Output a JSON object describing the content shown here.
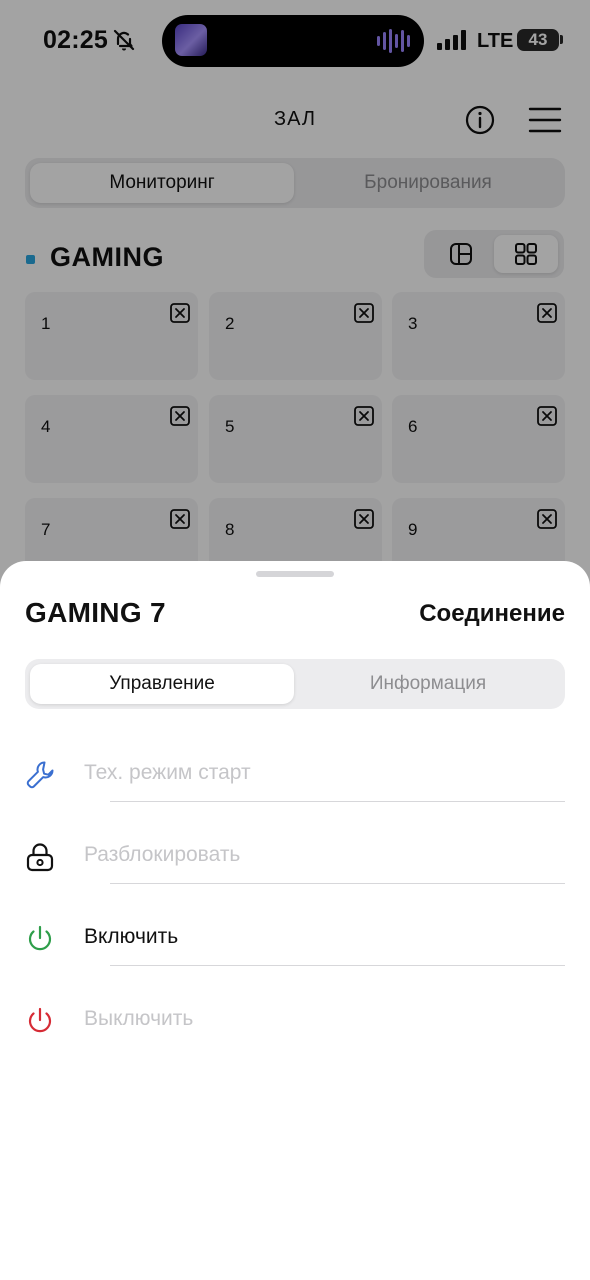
{
  "status_bar": {
    "time": "02:25",
    "network": "LTE",
    "battery": "43"
  },
  "header": {
    "title": "ЗАЛ"
  },
  "tabs": {
    "left": "Мониторинг",
    "right": "Бронирования"
  },
  "zone": {
    "name": "GAMING"
  },
  "tiles": [
    "1",
    "2",
    "3",
    "4",
    "5",
    "6",
    "7",
    "8",
    "9"
  ],
  "sheet": {
    "title": "GAMING 7",
    "status": "Соединение",
    "tabs": {
      "left": "Управление",
      "right": "Информация"
    },
    "actions": [
      {
        "label": "Тех. режим старт",
        "icon": "wrench-icon",
        "enabled": false
      },
      {
        "label": "Разблокировать",
        "icon": "lock-icon",
        "enabled": false
      },
      {
        "label": "Включить",
        "icon": "power-on-icon",
        "enabled": true
      },
      {
        "label": "Выключить",
        "icon": "power-off-icon",
        "enabled": false
      }
    ]
  },
  "colors": {
    "zone_dot": "#2aa7e0",
    "power_on": "#2e9e4a",
    "power_off": "#d62b35",
    "wrench": "#3a6fd0"
  }
}
